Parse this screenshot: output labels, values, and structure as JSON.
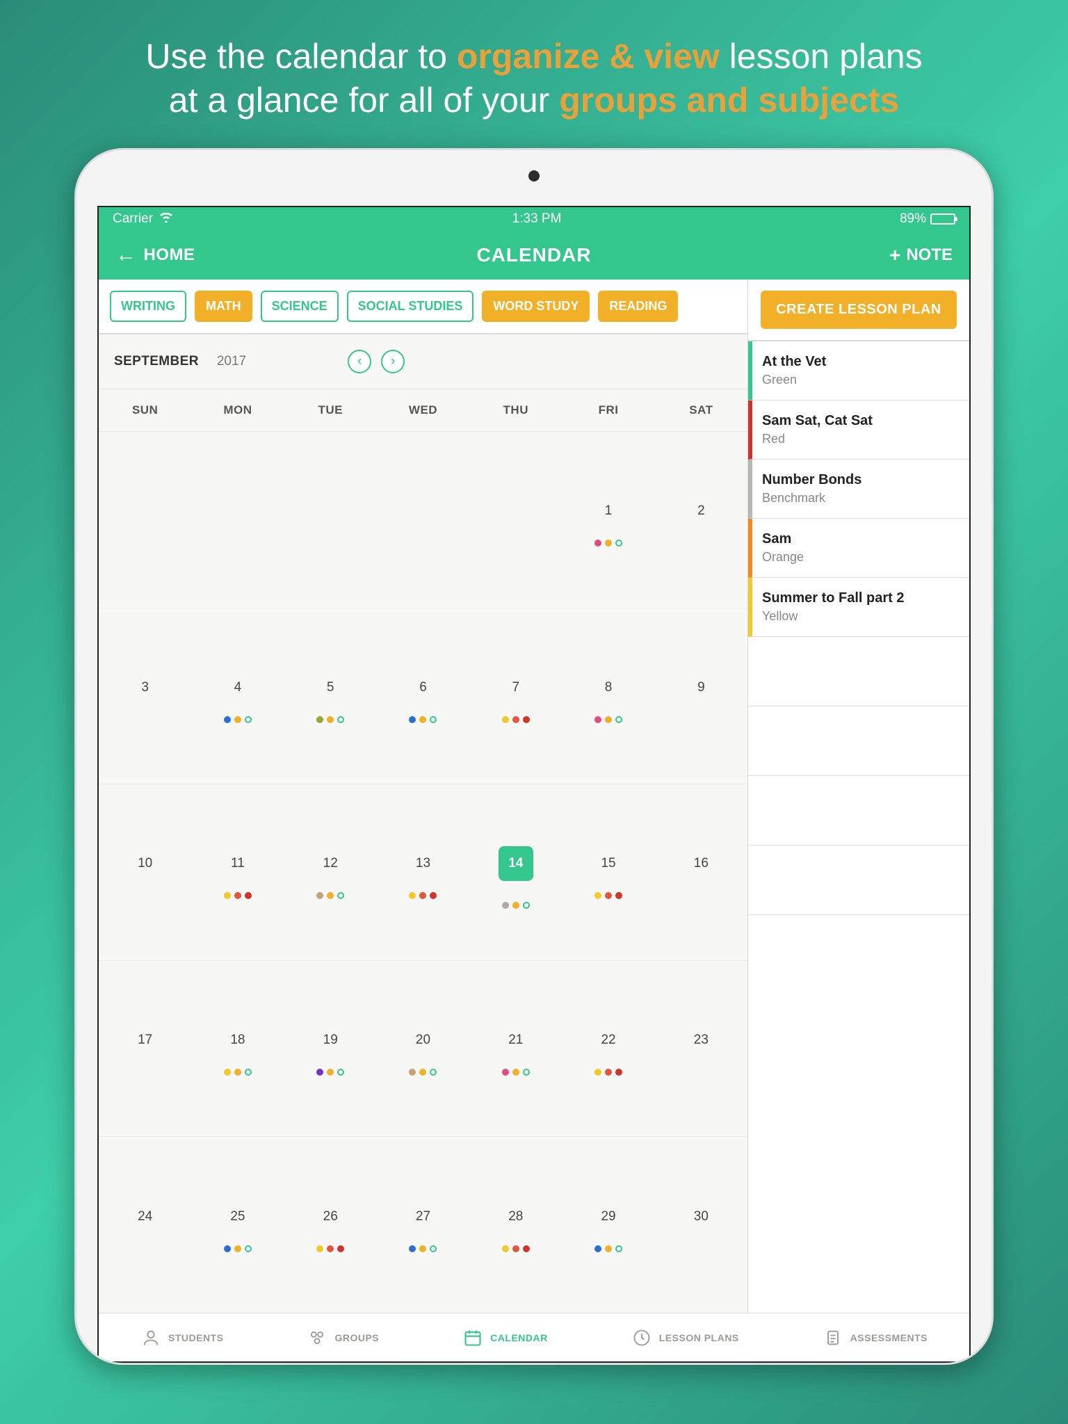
{
  "promo": {
    "line1_a": "Use the calendar to ",
    "line1_b": "organize & view",
    "line1_c": " lesson plans",
    "line2_a": "at a glance for all of your ",
    "line2_b": "groups and subjects"
  },
  "status": {
    "carrier": "Carrier",
    "time": "1:33 PM",
    "battery_pct": "89%"
  },
  "nav": {
    "home": "HOME",
    "title": "CALENDAR",
    "note": "NOTE"
  },
  "filters": [
    {
      "label": "WRITING",
      "active": false
    },
    {
      "label": "MATH",
      "active": true
    },
    {
      "label": "SCIENCE",
      "active": false
    },
    {
      "label": "SOCIAL STUDIES",
      "active": false
    },
    {
      "label": "WORD STUDY",
      "active": true
    },
    {
      "label": "READING",
      "active": true
    }
  ],
  "create_btn": "CREATE LESSON PLAN",
  "month": {
    "name": "SEPTEMBER",
    "year": "2017"
  },
  "weekdays": [
    "SUN",
    "MON",
    "TUE",
    "WED",
    "THU",
    "FRI",
    "SAT"
  ],
  "selected_day": 14,
  "weeks": [
    [
      {
        "d": null
      },
      {
        "d": null
      },
      {
        "d": null
      },
      {
        "d": null
      },
      {
        "d": null
      },
      {
        "d": 1,
        "dots": [
          {
            "c": "#e14b84"
          },
          {
            "c": "#f1b028"
          },
          {
            "c": "#34c78d",
            "hollow": true
          }
        ]
      },
      {
        "d": 2
      }
    ],
    [
      {
        "d": 3
      },
      {
        "d": 4,
        "dots": [
          {
            "c": "#2a6fd6"
          },
          {
            "c": "#f1b028"
          },
          {
            "c": "#34c78d",
            "hollow": true
          }
        ]
      },
      {
        "d": 5,
        "dots": [
          {
            "c": "#9aa72a"
          },
          {
            "c": "#f1b028"
          },
          {
            "c": "#34c78d",
            "hollow": true
          }
        ]
      },
      {
        "d": 6,
        "dots": [
          {
            "c": "#2a6fd6"
          },
          {
            "c": "#f1b028"
          },
          {
            "c": "#34c78d",
            "hollow": true
          }
        ]
      },
      {
        "d": 7,
        "dots": [
          {
            "c": "#f1c92a"
          },
          {
            "c": "#e0573e"
          },
          {
            "c": "#d0342c"
          }
        ]
      },
      {
        "d": 8,
        "dots": [
          {
            "c": "#e14b84"
          },
          {
            "c": "#f1b028"
          },
          {
            "c": "#34c78d",
            "hollow": true
          }
        ]
      },
      {
        "d": 9
      }
    ],
    [
      {
        "d": 10
      },
      {
        "d": 11,
        "dots": [
          {
            "c": "#f1c92a"
          },
          {
            "c": "#e0573e"
          },
          {
            "c": "#d0342c"
          }
        ]
      },
      {
        "d": 12,
        "dots": [
          {
            "c": "#c8a276"
          },
          {
            "c": "#f1b028"
          },
          {
            "c": "#34c78d",
            "hollow": true
          }
        ]
      },
      {
        "d": 13,
        "dots": [
          {
            "c": "#f1c92a"
          },
          {
            "c": "#e0573e"
          },
          {
            "c": "#d0342c"
          }
        ]
      },
      {
        "d": 14,
        "dots": [
          {
            "c": "#b0a8a2"
          },
          {
            "c": "#f1b028"
          },
          {
            "c": "#34c78d",
            "hollow": true
          }
        ]
      },
      {
        "d": 15,
        "dots": [
          {
            "c": "#f1c92a"
          },
          {
            "c": "#e0573e"
          },
          {
            "c": "#d0342c"
          }
        ]
      },
      {
        "d": 16
      }
    ],
    [
      {
        "d": 17
      },
      {
        "d": 18,
        "dots": [
          {
            "c": "#f1c92a"
          },
          {
            "c": "#f1b028"
          },
          {
            "c": "#34c78d",
            "hollow": true
          }
        ]
      },
      {
        "d": 19,
        "dots": [
          {
            "c": "#7b2fbf"
          },
          {
            "c": "#f1b028"
          },
          {
            "c": "#34c78d",
            "hollow": true
          }
        ]
      },
      {
        "d": 20,
        "dots": [
          {
            "c": "#c8a276"
          },
          {
            "c": "#f1b028"
          },
          {
            "c": "#34c78d",
            "hollow": true
          }
        ]
      },
      {
        "d": 21,
        "dots": [
          {
            "c": "#e14b84"
          },
          {
            "c": "#f1b028"
          },
          {
            "c": "#34c78d",
            "hollow": true
          }
        ]
      },
      {
        "d": 22,
        "dots": [
          {
            "c": "#f1c92a"
          },
          {
            "c": "#e0573e"
          },
          {
            "c": "#d0342c"
          }
        ]
      },
      {
        "d": 23
      }
    ],
    [
      {
        "d": 24
      },
      {
        "d": 25,
        "dots": [
          {
            "c": "#2a6fd6"
          },
          {
            "c": "#f1b028"
          },
          {
            "c": "#34c78d",
            "hollow": true
          }
        ]
      },
      {
        "d": 26,
        "dots": [
          {
            "c": "#f1c92a"
          },
          {
            "c": "#e0573e"
          },
          {
            "c": "#d0342c"
          }
        ]
      },
      {
        "d": 27,
        "dots": [
          {
            "c": "#2a6fd6"
          },
          {
            "c": "#f1b028"
          },
          {
            "c": "#34c78d",
            "hollow": true
          }
        ]
      },
      {
        "d": 28,
        "dots": [
          {
            "c": "#f1c92a"
          },
          {
            "c": "#e0573e"
          },
          {
            "c": "#d0342c"
          }
        ]
      },
      {
        "d": 29,
        "dots": [
          {
            "c": "#2a6fd6"
          },
          {
            "c": "#f1b028"
          },
          {
            "c": "#34c78d",
            "hollow": true
          }
        ]
      },
      {
        "d": 30
      }
    ]
  ],
  "plans": [
    {
      "title": "At the Vet",
      "sub": "Green",
      "color": "#34c78d"
    },
    {
      "title": "Sam Sat, Cat Sat",
      "sub": "Red",
      "color": "#d0342c"
    },
    {
      "title": "Number Bonds",
      "sub": "Benchmark",
      "color": "#b7b7b3"
    },
    {
      "title": "Sam",
      "sub": "Orange",
      "color": "#ef8a1f"
    },
    {
      "title": "Summer to Fall part 2",
      "sub": "Yellow",
      "color": "#f1c92a"
    }
  ],
  "tabs": [
    {
      "label": "STUDENTS",
      "icon": "student",
      "active": false
    },
    {
      "label": "GROUPS",
      "icon": "groups",
      "active": false
    },
    {
      "label": "CALENDAR",
      "icon": "calendar",
      "active": true
    },
    {
      "label": "LESSON PLANS",
      "icon": "lesson",
      "active": false
    },
    {
      "label": "ASSESSMENTS",
      "icon": "assess",
      "active": false
    }
  ]
}
